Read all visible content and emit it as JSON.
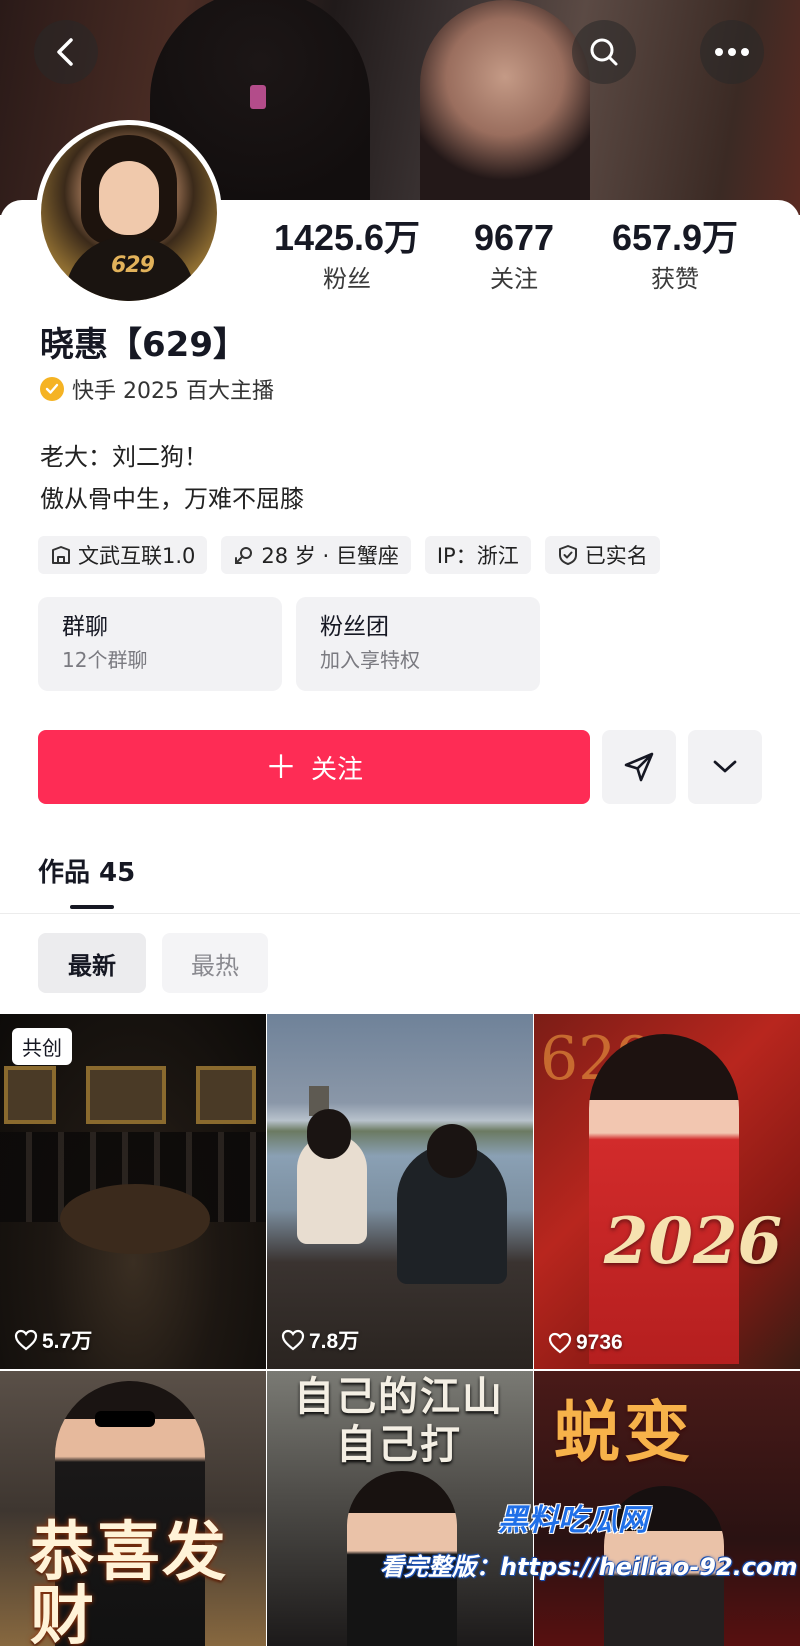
{
  "profile": {
    "name": "晓惠【629】",
    "verified_text": "快手 2025 百大主播",
    "bio_line1": "老大：刘二狗！",
    "bio_line2": "傲从骨中生，万难不屈膝",
    "avatar_badge": "629"
  },
  "stats": [
    {
      "value": "1425.6万",
      "label": "粉丝"
    },
    {
      "value": "9677",
      "label": "关注"
    },
    {
      "value": "657.9万",
      "label": "获赞"
    }
  ],
  "tags": [
    {
      "icon": "school-icon",
      "text": "文武互联1.0"
    },
    {
      "icon": "gender-icon",
      "text": "28 岁 · 巨蟹座"
    },
    {
      "icon": "",
      "text": "IP：浙江"
    },
    {
      "icon": "shield-check-icon",
      "text": "已实名"
    }
  ],
  "groups": [
    {
      "title": "群聊",
      "subtitle": "12个群聊"
    },
    {
      "title": "粉丝团",
      "subtitle": "加入享特权"
    }
  ],
  "actions": {
    "follow_label": "关注",
    "follow_color": "#fe2c55"
  },
  "tabs": {
    "works_label": "作品 45"
  },
  "sort": {
    "newest": "最新",
    "hottest": "最热"
  },
  "videos": [
    {
      "likes": "5.7万",
      "badge": "共创"
    },
    {
      "likes": "7.8万"
    },
    {
      "likes": "9736",
      "overlay": "2026",
      "bg_text": "629"
    },
    {
      "overlay": "恭喜发财"
    },
    {
      "overlay": "自己的江山自己打"
    },
    {
      "overlay": "蜕变"
    }
  ],
  "watermark": {
    "brand": "黑料吃瓜网",
    "url_text": "看完整版：https://heiliao-92.com"
  }
}
